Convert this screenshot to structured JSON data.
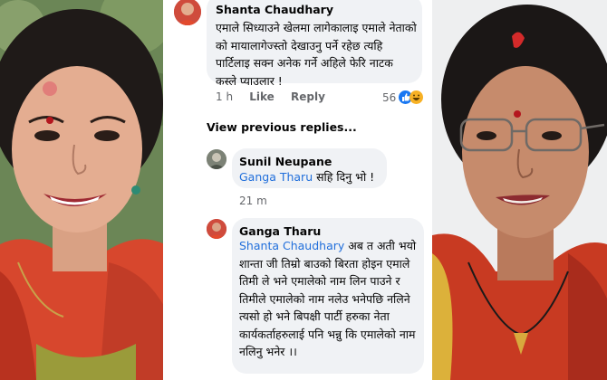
{
  "comment1": {
    "author": "Shanta Chaudhary",
    "text": "एमाले सिध्याउने खेलमा लागेकालाइ एमाले नेताको को मायालागेज्स्तो देखाउनु पर्ने रहेछ त्यहि पार्टिलाइ सक्न अनेक गर्ने अहिले फेरि नाटक कस्ले प्याउलार !",
    "time": "1 h",
    "like_label": "Like",
    "reply_label": "Reply",
    "reaction_count": "56"
  },
  "view_previous": "View previous replies...",
  "comment2": {
    "author": "Sunil Neupane",
    "mention": "Ganga Tharu",
    "text": " सहि दिनु भो !",
    "time": "21 m"
  },
  "comment3": {
    "author": "Ganga Tharu",
    "mention": "Shanta Chaudhary",
    "text": " अब त अती भयो शान्ता जी तिम्रो बाउको बिरता होइन एमाले तिमी ले भने एमालेको नाम लिन पाउने र  तिमीले एमालेको नाम नलेउ भनेपछि नलिने त्यसो हो भने बिपक्षी पार्टी हरुका नेता कार्यकर्ताहरुलाई पनि भन्नु कि एमालेको नाम नलिनु भनेर ।।"
  },
  "colors": {
    "mention": "#216fdb",
    "bubble": "#f0f2f5",
    "meta": "#65676b"
  },
  "icons": [
    "like-reaction-icon",
    "haha-reaction-icon"
  ]
}
